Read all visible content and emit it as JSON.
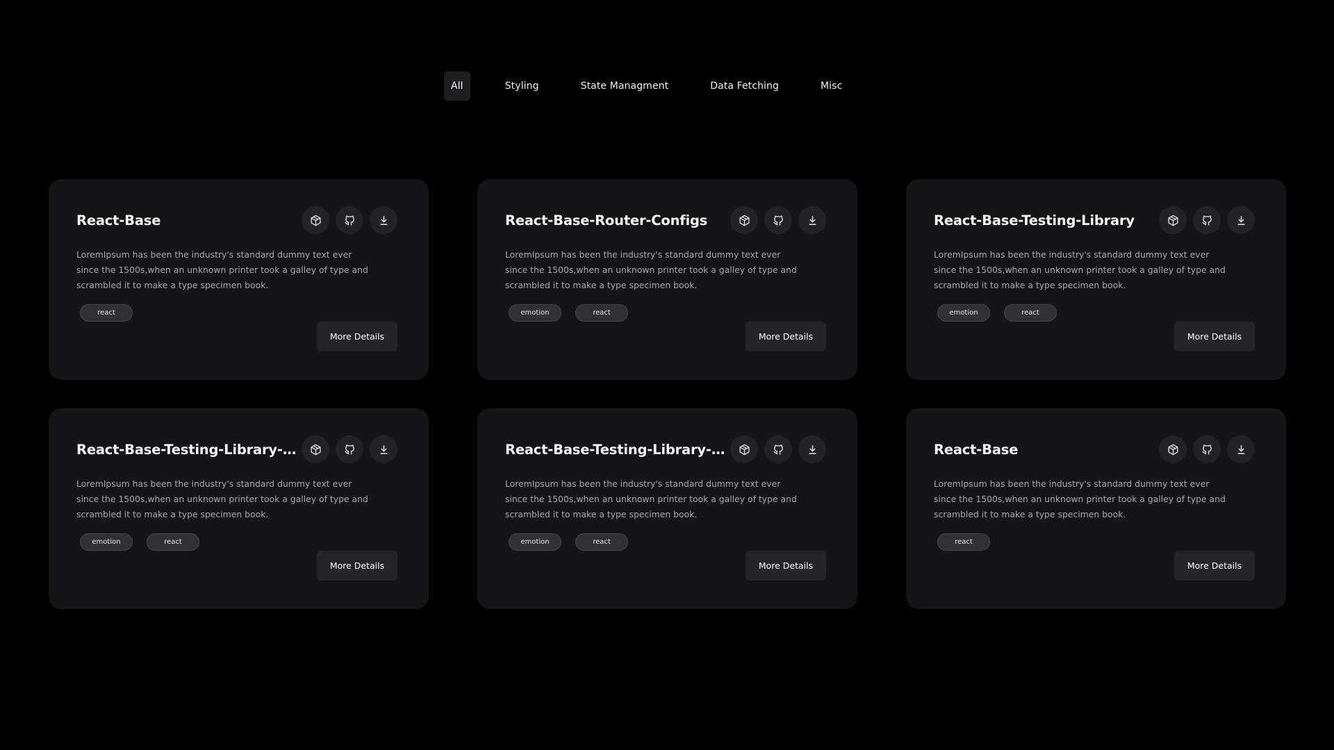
{
  "filters": [
    {
      "label": "All",
      "active": true
    },
    {
      "label": "Styling",
      "active": false
    },
    {
      "label": "State Managment",
      "active": false
    },
    {
      "label": "Data Fetching",
      "active": false
    },
    {
      "label": "Misc",
      "active": false
    }
  ],
  "cards": [
    {
      "title": "React-Base",
      "description": "LoremIpsum has been the industry's standard dummy text ever since the 1500s,when an unknown printer took a galley of type and scrambled it to make a type specimen book.",
      "tags": [
        "react"
      ],
      "button": "More Details"
    },
    {
      "title": "React-Base-Router-Configs",
      "description": "LoremIpsum has been the industry's standard dummy text ever since the 1500s,when an unknown printer took a galley of type and scrambled it to make a type specimen book.",
      "tags": [
        "emotion",
        "react"
      ],
      "button": "More Details"
    },
    {
      "title": "React-Base-Testing-Library",
      "description": "LoremIpsum has been the industry's standard dummy text ever since the 1500s,when an unknown printer took a galley of type and scrambled it to make a type specimen book.",
      "tags": [
        "emotion",
        "react"
      ],
      "button": "More Details"
    },
    {
      "title": "React-Base-Testing-Library-Re...",
      "description": "LoremIpsum has been the industry's standard dummy text ever since the 1500s,when an unknown printer took a galley of type and scrambled it to make a type specimen book.",
      "tags": [
        "emotion",
        "react"
      ],
      "button": "More Details"
    },
    {
      "title": "React-Base-Testing-Library-A...",
      "description": "LoremIpsum has been the industry's standard dummy text ever since the 1500s,when an unknown printer took a galley of type and scrambled it to make a type specimen book.",
      "tags": [
        "emotion",
        "react"
      ],
      "button": "More Details"
    },
    {
      "title": "React-Base",
      "description": "LoremIpsum has been the industry's standard dummy text ever since the 1500s,when an unknown printer took a galley of type and scrambled it to make a type specimen book.",
      "tags": [
        "react"
      ],
      "button": "More Details"
    }
  ],
  "icons": [
    "package-icon",
    "github-icon",
    "download-icon"
  ],
  "colors": {
    "background": "#000000",
    "card": "#151517",
    "icon_button": "#232326",
    "tag": "#313134",
    "button": "#252528",
    "text_muted": "#a9a9ae"
  }
}
